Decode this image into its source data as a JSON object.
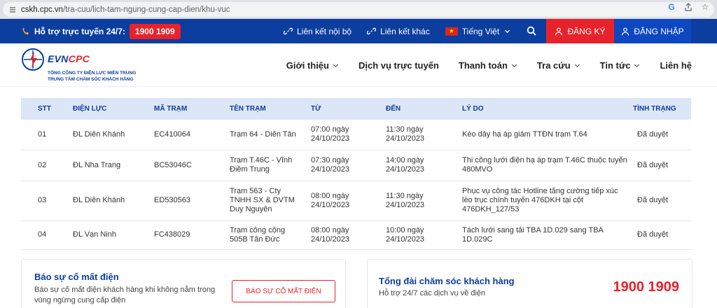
{
  "browser": {
    "url_host": "cskh.cpc.vn",
    "url_path": "/tra-cuu/lich-tam-ngung-cung-cap-dien/khu-vuc"
  },
  "topbar": {
    "hotline_label": "Hỗ trợ trực tuyến 24/7:",
    "hotline_number": "1900 1909",
    "link_internal": "Liên kết nội bộ",
    "link_external": "Liên kết khác",
    "language": "Tiếng Việt",
    "register": "ĐĂNG KÝ",
    "login": "ĐĂNG NHẬP"
  },
  "logo": {
    "word_evn": "EVN",
    "word_cpc": "CPC",
    "line1": "TỔNG CÔNG TY ĐIỆN LỰC MIỀN TRUNG",
    "line2": "TRUNG TÂM CHĂM SÓC KHÁCH HÀNG"
  },
  "nav": {
    "items": [
      {
        "label": "Giới thiệu",
        "dropdown": true
      },
      {
        "label": "Dịch vụ trực tuyến",
        "dropdown": false
      },
      {
        "label": "Thanh toán",
        "dropdown": true
      },
      {
        "label": "Tra cứu",
        "dropdown": true
      },
      {
        "label": "Tin tức",
        "dropdown": true
      },
      {
        "label": "Liên hệ",
        "dropdown": false
      }
    ]
  },
  "table": {
    "headers": [
      "STT",
      "ĐIỆN LỰC",
      "MÃ TRẠM",
      "TÊN TRẠM",
      "TỪ",
      "ĐẾN",
      "LÝ DO",
      "TÌNH TRẠNG"
    ],
    "rows": [
      [
        "01",
        "ĐL Diên Khánh",
        "EC410064",
        "Trạm 64 - Diên Tân",
        "07:00 ngày 24/10/2023",
        "11:30 ngày 24/10/2023",
        "Kéo dây hạ áp giảm TTĐN trạm T.64",
        "Đã duyệt"
      ],
      [
        "02",
        "ĐL Nha Trang",
        "BC53046C",
        "Trạm T.46C - Vĩnh Điềm Trung",
        "07:30 ngày 24/10/2023",
        "14:00 ngày 24/10/2023",
        "Thi công lưới điện hạ áp trạm T.46C thuộc tuyến 480MVO",
        "Đã duyệt"
      ],
      [
        "03",
        "ĐL Diên Khánh",
        "ED530563",
        "Trạm 563 - Cty TNHH SX & DVTM Duy Nguyên",
        "08:00 ngày 24/10/2023",
        "11:30 ngày 24/10/2023",
        "Phục vụ công tác Hotline tăng cường tiếp xúc lèo trục chính tuyến 476DKH tại cột 476DKH_127/53",
        "Đã duyệt"
      ],
      [
        "04",
        "ĐL Vạn Ninh",
        "FC438029",
        "Trạm công cộng 505B Tân Đức",
        "08:00 ngày 24/10/2023",
        "10:00 ngày 24/10/2023",
        "Tách lưới sang tải TBA 1D.029 sang TBA 1D.029C",
        "Đã duyệt"
      ]
    ]
  },
  "report_card": {
    "title": "Báo sự cố mất điện",
    "description": "Báo sự cố mất điện khách hàng khi không nằm trong vùng ngừng cung cấp điện",
    "button": "BÁO SỰ CỐ MẤT ĐIỆN"
  },
  "support_card": {
    "title": "Tổng đài chăm sóc khách hàng",
    "description": "Hỗ trợ 24/7 các dịch vụ về điện",
    "number": "1900 1909"
  },
  "colors": {
    "primary_blue": "#0b3e9e",
    "accent_red": "#e8222b",
    "login_blue": "#0d47c1",
    "table_header_bg": "#dde6f7"
  }
}
